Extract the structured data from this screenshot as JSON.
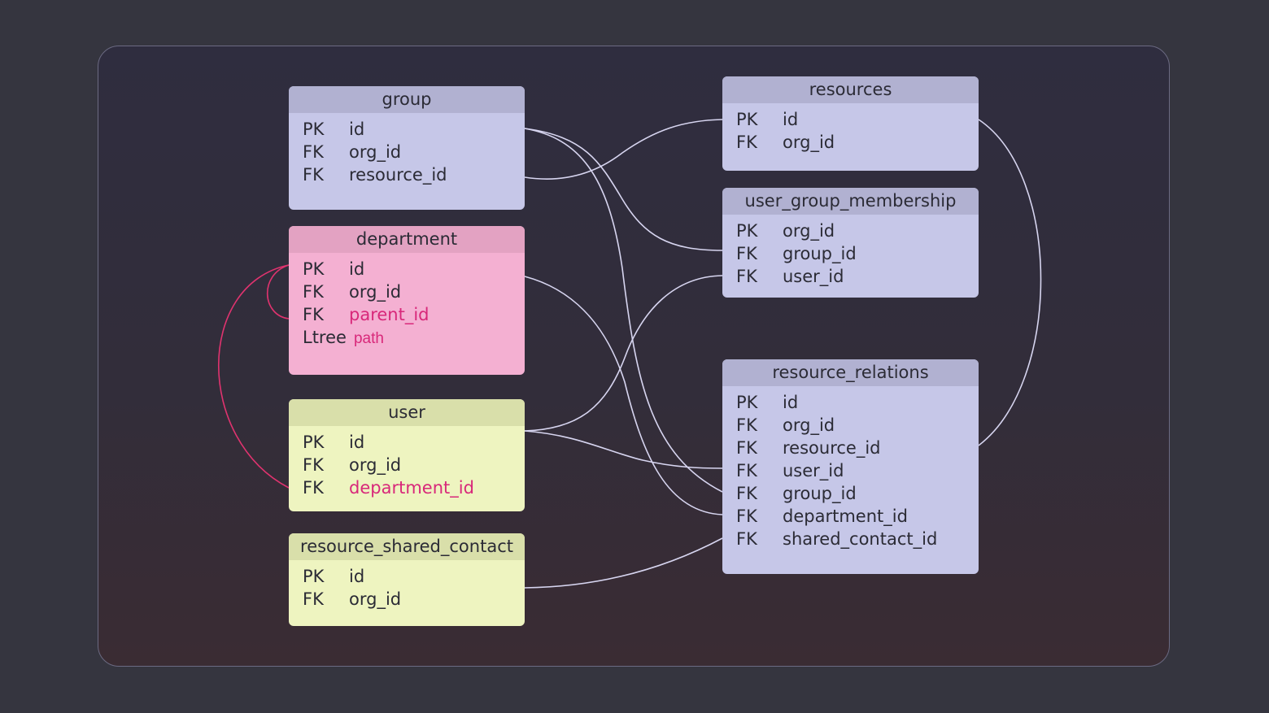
{
  "colors": {
    "background": "#35353f",
    "frame_border": "#6b6a82",
    "lavender_header": "#b1b1d1",
    "lavender_body": "#c6c7e8",
    "pink_header": "#e3a2c2",
    "pink_body": "#f4b0d2",
    "lime_header": "#d9dfaa",
    "lime_body": "#eef4c0",
    "connector": "#d7d5f0",
    "self_reference_connector": "#e0336f",
    "highlight_text": "#d8287a"
  },
  "entities": {
    "group": {
      "title": "group",
      "fields": [
        {
          "key": "PK",
          "name": "id"
        },
        {
          "key": "FK",
          "name": "org_id"
        },
        {
          "key": "FK",
          "name": "resource_id"
        }
      ]
    },
    "department": {
      "title": "department",
      "fields": [
        {
          "key": "PK",
          "name": "id"
        },
        {
          "key": "FK",
          "name": "org_id"
        },
        {
          "key": "FK",
          "name": "parent_id"
        },
        {
          "key": "Ltree",
          "name": "path"
        }
      ]
    },
    "user": {
      "title": "user",
      "fields": [
        {
          "key": "PK",
          "name": "id"
        },
        {
          "key": "FK",
          "name": "org_id"
        },
        {
          "key": "FK",
          "name": "department_id"
        }
      ]
    },
    "resource_shared_contact": {
      "title": "resource_shared_contact",
      "fields": [
        {
          "key": "PK",
          "name": "id"
        },
        {
          "key": "FK",
          "name": "org_id"
        }
      ]
    },
    "resources": {
      "title": "resources",
      "fields": [
        {
          "key": "PK",
          "name": "id"
        },
        {
          "key": "FK",
          "name": "org_id"
        }
      ]
    },
    "user_group_membership": {
      "title": "user_group_membership",
      "fields": [
        {
          "key": "PK",
          "name": "org_id"
        },
        {
          "key": "FK",
          "name": "group_id"
        },
        {
          "key": "FK",
          "name": "user_id"
        }
      ]
    },
    "resource_relations": {
      "title": "resource_relations",
      "fields": [
        {
          "key": "PK",
          "name": "id"
        },
        {
          "key": "FK",
          "name": "org_id"
        },
        {
          "key": "FK",
          "name": "resource_id"
        },
        {
          "key": "FK",
          "name": "user_id"
        },
        {
          "key": "FK",
          "name": "group_id"
        },
        {
          "key": "FK",
          "name": "department_id"
        },
        {
          "key": "FK",
          "name": "shared_contact_id"
        }
      ]
    }
  },
  "relationships": [
    {
      "from": "group.id",
      "to": "user_group_membership.group_id"
    },
    {
      "from": "group.id",
      "to": "resource_relations.group_id"
    },
    {
      "from": "group.resource_id",
      "to": "resources.id"
    },
    {
      "from": "department.id",
      "to": "resource_relations.department_id"
    },
    {
      "from": "department.parent_id",
      "to": "department.id"
    },
    {
      "from": "user.department_id",
      "to": "department.id"
    },
    {
      "from": "user.id",
      "to": "user_group_membership.user_id"
    },
    {
      "from": "user.id",
      "to": "resource_relations.user_id"
    },
    {
      "from": "resource_shared_contact.id",
      "to": "resource_relations.shared_contact_id"
    },
    {
      "from": "resources.id",
      "to": "resource_relations.resource_id"
    }
  ]
}
